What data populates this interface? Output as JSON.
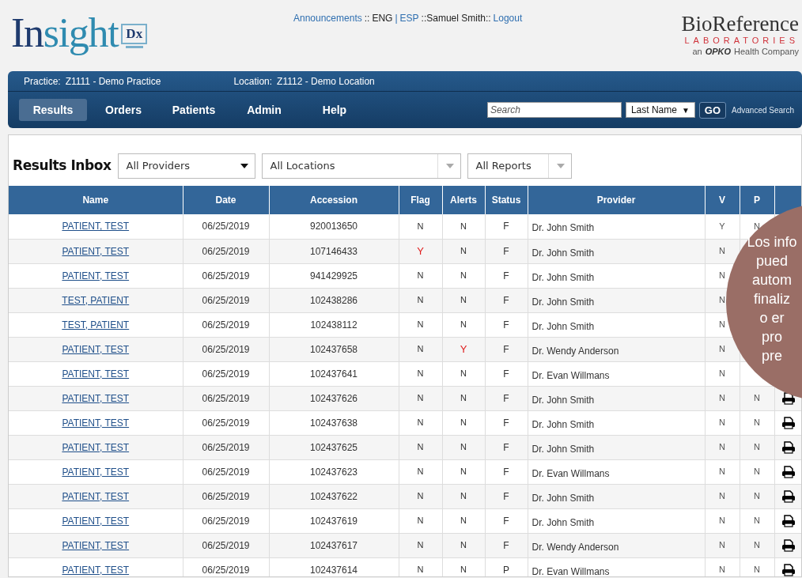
{
  "logo": {
    "word_dark": "In",
    "word_teal": "sight",
    "badge": "Dx"
  },
  "top_links": [
    {
      "kind": "link",
      "text": "Announcements"
    },
    {
      "kind": "text",
      "text": "::"
    },
    {
      "kind": "text",
      "text": "ENG"
    },
    {
      "kind": "sep",
      "text": "|"
    },
    {
      "kind": "link",
      "text": "ESP"
    },
    {
      "kind": "text",
      "text": "::Samuel Smith::"
    },
    {
      "kind": "link",
      "text": "Logout"
    }
  ],
  "brand": {
    "name": "BioReference",
    "sub": "LABORATORIES",
    "tag_pre": "an",
    "tag_brand": "OPKO",
    "tag_post": "Health Company"
  },
  "context": [
    {
      "label": "Practice:",
      "value": "Z1111 - Demo Practice"
    },
    {
      "label": "Location:",
      "value": "Z1112 - Demo Location"
    }
  ],
  "nav": [
    {
      "label": "Results",
      "selected": true
    },
    {
      "label": "Orders",
      "selected": false
    },
    {
      "label": "Patients",
      "selected": false
    },
    {
      "label": "Admin",
      "selected": false
    },
    {
      "label": "Help",
      "selected": false
    }
  ],
  "search": {
    "placeholder": "Search",
    "mode": "Last Name",
    "mode_caret": "▼",
    "go": "GO",
    "advanced": "Advanced Search"
  },
  "inbox": {
    "title": "Results Inbox",
    "filters": [
      {
        "kind": "dark",
        "value": "All Providers"
      },
      {
        "kind": "grey",
        "value": "All Locations"
      },
      {
        "kind": "grey",
        "value": "All Reports"
      }
    ]
  },
  "table": {
    "columns": [
      "Name",
      "Date",
      "Accession",
      "Flag",
      "Alerts",
      "Status",
      "Provider",
      "V",
      "P"
    ],
    "rows": [
      {
        "name": "PATIENT, TEST",
        "date": "06/25/2019",
        "accession": "920013650",
        "flag": "N",
        "alerts": "N",
        "status": "F",
        "provider": "Dr. John Smith",
        "v": "Y",
        "p": "N"
      },
      {
        "name": "PATIENT, TEST",
        "date": "06/25/2019",
        "accession": "107146433",
        "flag": "Y",
        "alerts": "N",
        "status": "F",
        "provider": "Dr. John Smith",
        "v": "N"
      },
      {
        "name": "PATIENT, TEST",
        "date": "06/25/2019",
        "accession": "941429925",
        "flag": "N",
        "alerts": "N",
        "status": "F",
        "provider": "Dr. John Smith",
        "v": "N"
      },
      {
        "name": "TEST, PATIENT",
        "date": "06/25/2019",
        "accession": "102438286",
        "flag": "N",
        "alerts": "N",
        "status": "F",
        "provider": "Dr. John Smith",
        "v": "N"
      },
      {
        "name": "TEST, PATIENT",
        "date": "06/25/2019",
        "accession": "102438112",
        "flag": "N",
        "alerts": "N",
        "status": "F",
        "provider": "Dr. John Smith",
        "v": "N"
      },
      {
        "name": "PATIENT, TEST",
        "date": "06/25/2019",
        "accession": "102437658",
        "flag": "N",
        "alerts": "Y",
        "status": "F",
        "provider": "Dr. Wendy Anderson",
        "v": "N"
      },
      {
        "name": "PATIENT, TEST",
        "date": "06/25/2019",
        "accession": "102437641",
        "flag": "N",
        "alerts": "N",
        "status": "F",
        "provider": "Dr. Evan Willmans",
        "v": "N"
      },
      {
        "name": "PATIENT, TEST",
        "date": "06/25/2019",
        "accession": "102437626",
        "flag": "N",
        "alerts": "N",
        "status": "F",
        "provider": "Dr. John Smith",
        "v": "N",
        "p": "N"
      },
      {
        "name": "PATIENT, TEST",
        "date": "06/25/2019",
        "accession": "102437638",
        "flag": "N",
        "alerts": "N",
        "status": "F",
        "provider": "Dr. John Smith",
        "v": "N",
        "p": "N"
      },
      {
        "name": "PATIENT, TEST",
        "date": "06/25/2019",
        "accession": "102437625",
        "flag": "N",
        "alerts": "N",
        "status": "F",
        "provider": "Dr. John Smith",
        "v": "N",
        "p": "N"
      },
      {
        "name": "PATIENT, TEST",
        "date": "06/25/2019",
        "accession": "102437623",
        "flag": "N",
        "alerts": "N",
        "status": "F",
        "provider": "Dr. Evan Willmans",
        "v": "N",
        "p": "N"
      },
      {
        "name": "PATIENT, TEST",
        "date": "06/25/2019",
        "accession": "102437622",
        "flag": "N",
        "alerts": "N",
        "status": "F",
        "provider": "Dr. John Smith",
        "v": "N",
        "p": "N"
      },
      {
        "name": "PATIENT, TEST",
        "date": "06/25/2019",
        "accession": "102437619",
        "flag": "N",
        "alerts": "N",
        "status": "F",
        "provider": "Dr. John Smith",
        "v": "N",
        "p": "N"
      },
      {
        "name": "PATIENT, TEST",
        "date": "06/25/2019",
        "accession": "102437617",
        "flag": "N",
        "alerts": "N",
        "status": "F",
        "provider": "Dr. Wendy Anderson",
        "v": "N",
        "p": "N"
      },
      {
        "name": "PATIENT, TEST",
        "date": "06/25/2019",
        "accession": "102437614",
        "flag": "N",
        "alerts": "N",
        "status": "P",
        "provider": "Dr. Evan Willmans",
        "v": "N",
        "p": "N"
      }
    ]
  },
  "callout": {
    "lines": [
      "Los info",
      "pued",
      "autom",
      "finaliz",
      "o er",
      "pro",
      "pre"
    ]
  }
}
